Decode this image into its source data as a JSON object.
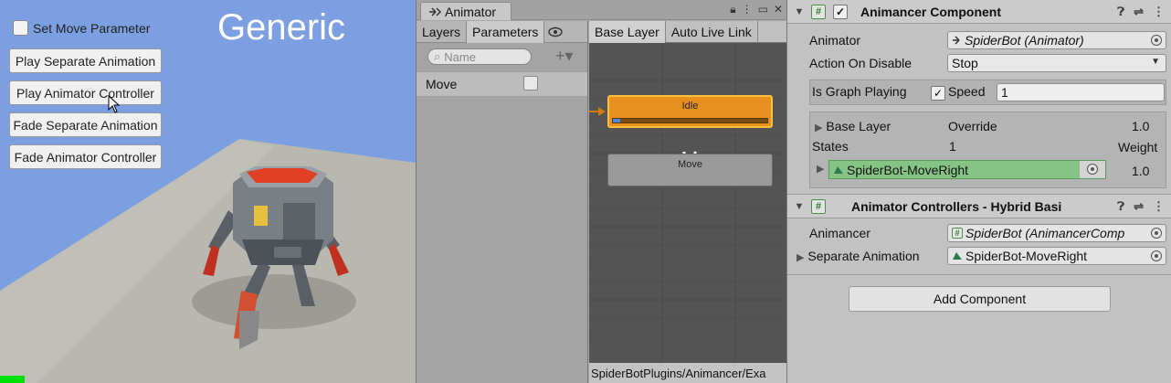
{
  "game": {
    "title": "Generic",
    "toggle_label": "Set Move Parameter",
    "buttons": [
      "Play Separate Animation",
      "Play Animator Controller",
      "Fade Separate Animation",
      "Fade Animator Controller"
    ],
    "sky_color": "#7b9fe0"
  },
  "animator": {
    "window_title": "Animator",
    "tabs": [
      "Layers",
      "Parameters"
    ],
    "search_placeholder": "Name",
    "parameters": [
      {
        "name": "Move",
        "value": false
      }
    ],
    "graph_tabs": [
      "Base Layer",
      "Auto Live Link"
    ],
    "states": {
      "idle": "Idle",
      "move": "Move"
    },
    "idle_progress": 0.05,
    "footer_path": "SpiderBotPlugins/Animancer/Exa",
    "accent": "#e8901e"
  },
  "inspector": {
    "animancer_component": {
      "title": "Animancer Component",
      "animator_label": "Animator",
      "animator_value": "SpiderBot (Animator)",
      "action_label": "Action On Disable",
      "action_value": "Stop",
      "graph_playing_label": "Is Graph Playing",
      "graph_playing": true,
      "speed_label": "Speed",
      "speed_value": "1",
      "layer_label": "Base Layer",
      "layer_mode": "Override",
      "layer_weight": "1.0",
      "states_label": "States",
      "states_count": "1",
      "weight_label": "Weight",
      "state_name": "SpiderBot-MoveRight",
      "state_weight": "1.0"
    },
    "hybrid_component": {
      "title": "Animator Controllers - Hybrid Basi",
      "animancer_label": "Animancer",
      "animancer_value": "SpiderBot (AnimancerComp",
      "separate_label": "Separate Animation",
      "separate_value": "SpiderBot-MoveRight"
    },
    "add_component": "Add Component"
  }
}
